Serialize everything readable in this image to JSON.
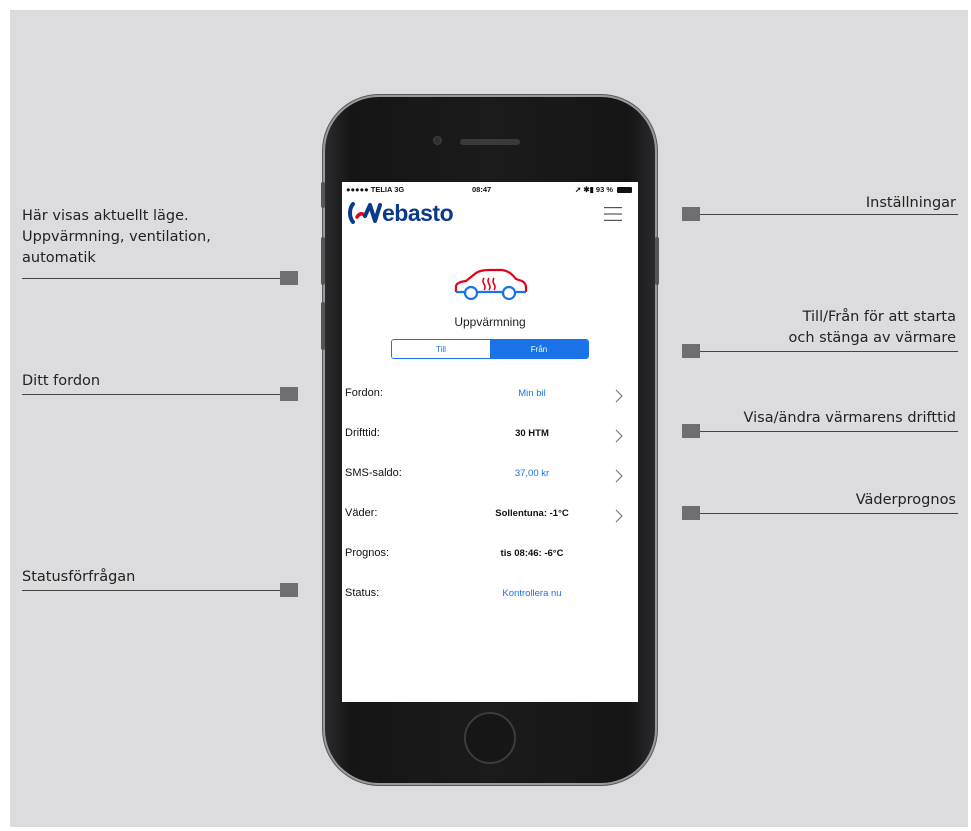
{
  "annotations": {
    "left": [
      {
        "lines": [
          "Här visas aktuellt läge.",
          "Uppvärmning, ventilation,",
          "automatik"
        ]
      },
      {
        "lines": [
          "Ditt fordon"
        ]
      },
      {
        "lines": [
          "Statusförfrågan"
        ]
      }
    ],
    "right": [
      {
        "lines": [
          "Inställningar"
        ]
      },
      {
        "lines": [
          "Till/Från för att starta",
          "och stänga av värmare"
        ]
      },
      {
        "lines": [
          "Visa/ändra värmarens drifttid"
        ]
      },
      {
        "lines": [
          "Väderprognos"
        ]
      }
    ]
  },
  "status_bar": {
    "carrier": "●●●●● TELIA  3G",
    "time": "08:47",
    "right": "➚ ✱▮ 93 %"
  },
  "app": {
    "logo": "ebasto",
    "mode_label": "Uppvärmning",
    "toggle": {
      "on_label": "Till",
      "off_label": "Från",
      "selected": "Från"
    },
    "rows": [
      {
        "label": "Fordon:",
        "value": "Min bil",
        "style": "blue",
        "chevron": true
      },
      {
        "label": "Drifttid:",
        "value": "30 HTM",
        "style": "bold",
        "chevron": true
      },
      {
        "label": "SMS-saldo:",
        "value": "37,00 kr",
        "style": "blue",
        "chevron": true
      },
      {
        "label": "Väder:",
        "value": "Sollentuna: -1°C",
        "style": "bold",
        "chevron": true
      },
      {
        "label": "Prognos:",
        "value": "tis 08:46: -6°C",
        "style": "bold",
        "chevron": false
      },
      {
        "label": "Status:",
        "value": "Kontrollera nu",
        "style": "blue",
        "chevron": false
      }
    ]
  },
  "colors": {
    "accent": "#1a73e8",
    "logo_blue": "#0a3a8c",
    "logo_red": "#e3001b",
    "background": "#dcdcde"
  },
  "icons": [
    "menu-icon",
    "car-heater-icon",
    "chevron-right-icon",
    "battery-icon"
  ]
}
